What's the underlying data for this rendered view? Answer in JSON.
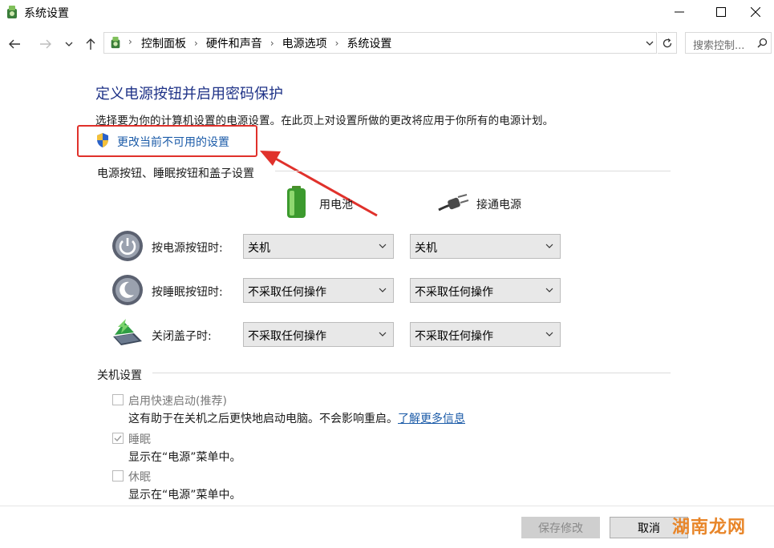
{
  "window": {
    "title": "系统设置"
  },
  "address_bar": {
    "breadcrumbs": [
      "控制面板",
      "硬件和声音",
      "电源选项",
      "系统设置"
    ],
    "search_placeholder": "搜索控制..."
  },
  "page": {
    "heading": "定义电源按钮并启用密码保护",
    "description": "选择要为你的计算机设置的电源设置。在此页上对设置所做的更改将应用于你所有的电源计划。",
    "change_link": "更改当前不可用的设置"
  },
  "power_section": {
    "title": "电源按钮、睡眠按钮和盖子设置",
    "battery_label": "用电池",
    "plugged_label": "接通电源",
    "rows": [
      {
        "label": "按电源按钮时:",
        "battery": "关机",
        "plugged": "关机",
        "icon": "power-icon"
      },
      {
        "label": "按睡眠按钮时:",
        "battery": "不采取任何操作",
        "plugged": "不采取任何操作",
        "icon": "sleep-icon"
      },
      {
        "label": "关闭盖子时:",
        "battery": "不采取任何操作",
        "plugged": "不采取任何操作",
        "icon": "lid-icon"
      }
    ]
  },
  "shutdown_section": {
    "title": "关机设置",
    "items": [
      {
        "label": "启用快速启动(推荐)",
        "desc": "这有助于在关机之后更快地启动电脑。不会影响重启。",
        "link": "了解更多信息",
        "checked": false
      },
      {
        "label": "睡眠",
        "desc": "显示在“电源”菜单中。",
        "checked": true
      },
      {
        "label": "休眠",
        "desc": "显示在“电源”菜单中。",
        "checked": false
      }
    ]
  },
  "footer": {
    "save_label": "保存修改",
    "cancel_label": "取消"
  },
  "watermark": "湖南龙网",
  "colors": {
    "heading": "#1e3287",
    "link": "#1b5ba8",
    "highlight_box": "#e0312b",
    "arrow": "#e0312b"
  }
}
